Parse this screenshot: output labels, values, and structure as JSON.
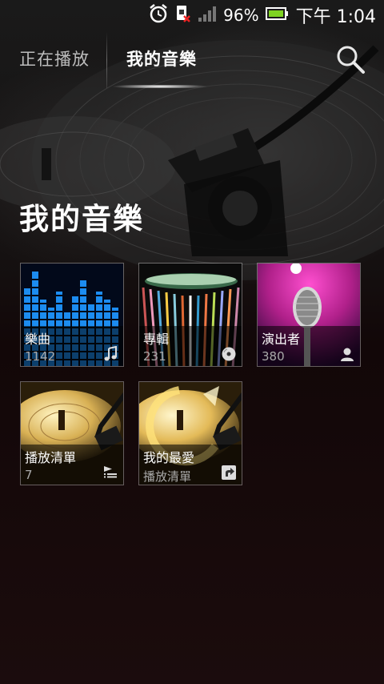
{
  "status_bar": {
    "battery_percent": "96%",
    "time": "下午 1:04",
    "icons": [
      "alarm-icon",
      "no-sim-icon",
      "signal-icon",
      "battery-icon"
    ]
  },
  "tabs": [
    {
      "label": "正在播放",
      "active": false
    },
    {
      "label": "我的音樂",
      "active": true
    }
  ],
  "search_icon": "search-icon",
  "page_title": "我的音樂",
  "tiles": [
    {
      "title": "樂曲",
      "subtitle": "1142",
      "icon": "music-note-icon"
    },
    {
      "title": "專輯",
      "subtitle": "231",
      "icon": "disc-icon"
    },
    {
      "title": "演出者",
      "subtitle": "380",
      "icon": "person-icon"
    },
    {
      "title": "播放清單",
      "subtitle": "7",
      "icon": "playlist-icon"
    },
    {
      "title": "我的最愛",
      "subtitle": "播放清單",
      "icon": "shortcut-arrow-icon"
    }
  ],
  "colors": {
    "background": "#0e0708",
    "accent": "#ffffff",
    "subtitle": "#a9a9a9"
  }
}
